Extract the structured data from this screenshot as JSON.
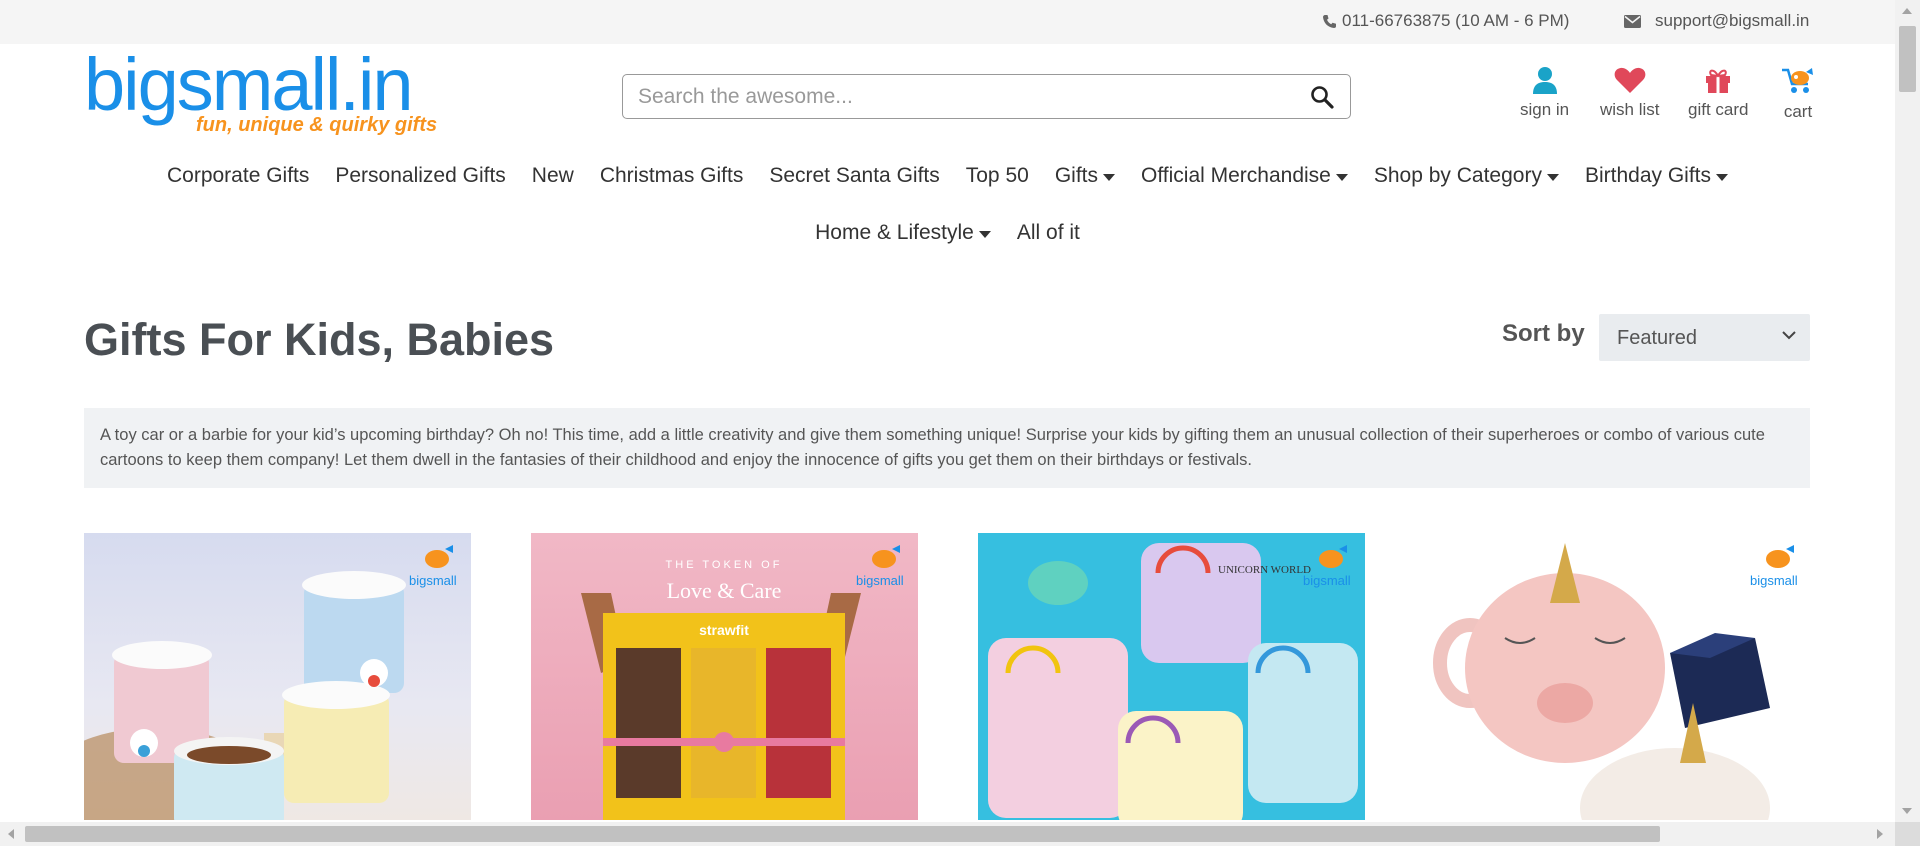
{
  "topbar": {
    "phone": "011-66763875 (10 AM - 6 PM)",
    "email": "support@bigsmall.in",
    "phone_icon": "phone-icon",
    "email_icon": "envelope-icon"
  },
  "header": {
    "logo_text": "bigsmall.in",
    "logo_tagline": "fun, unique & quirky gifts",
    "search_placeholder": "Search the awesome...",
    "search_icon": "search-icon",
    "icons": {
      "sign_in": "sign in",
      "wish_list": "wish list",
      "gift_card": "gift card",
      "cart": "cart"
    }
  },
  "nav": {
    "row1": [
      {
        "label": "Corporate Gifts",
        "dropdown": false
      },
      {
        "label": "Personalized Gifts",
        "dropdown": false
      },
      {
        "label": "New",
        "dropdown": false
      },
      {
        "label": "Christmas Gifts",
        "dropdown": false
      },
      {
        "label": "Secret Santa Gifts",
        "dropdown": false
      },
      {
        "label": "Top 50",
        "dropdown": false
      },
      {
        "label": "Gifts",
        "dropdown": true
      },
      {
        "label": "Official Merchandise",
        "dropdown": true
      },
      {
        "label": "Shop by Category",
        "dropdown": true
      },
      {
        "label": "Birthday Gifts",
        "dropdown": true
      }
    ],
    "row2": [
      {
        "label": "Home & Lifestyle",
        "dropdown": true
      },
      {
        "label": "All of it",
        "dropdown": false
      }
    ]
  },
  "page": {
    "title": "Gifts For Kids, Babies",
    "sort_label": "Sort by",
    "sort_value": "Featured",
    "description": "A toy car or a barbie for your kid’s upcoming birthday? Oh no! This time, add a little creativity and give them something unique! Surprise your kids by gifting them an unusual collection of their superheroes or combo of various cute cartoons to keep them company! Let them dwell in the fantasies of their childhood and enjoy the innocence of gifts you get them on their birthdays or festivals."
  },
  "products": [
    {
      "image": "polar-bear-mugs-image",
      "watermark": "bigsmall.in"
    },
    {
      "image": "strawfit-gift-box-image",
      "watermark": "bigsmall.in",
      "banner_line1": "THE TOKEN OF",
      "banner_line2": "Love & Care",
      "brand": "strawfit"
    },
    {
      "image": "unicorn-pouches-image",
      "watermark": "bigsmall.in",
      "pouch_text": "UNICORN WORLD"
    },
    {
      "image": "unicorn-mug-image",
      "watermark": "bigsmall.in"
    }
  ],
  "colors": {
    "brand_blue": "#1a8fe8",
    "brand_orange": "#f7931e",
    "wishlist_red": "#e0485a",
    "signin_teal": "#1aa3c8"
  }
}
